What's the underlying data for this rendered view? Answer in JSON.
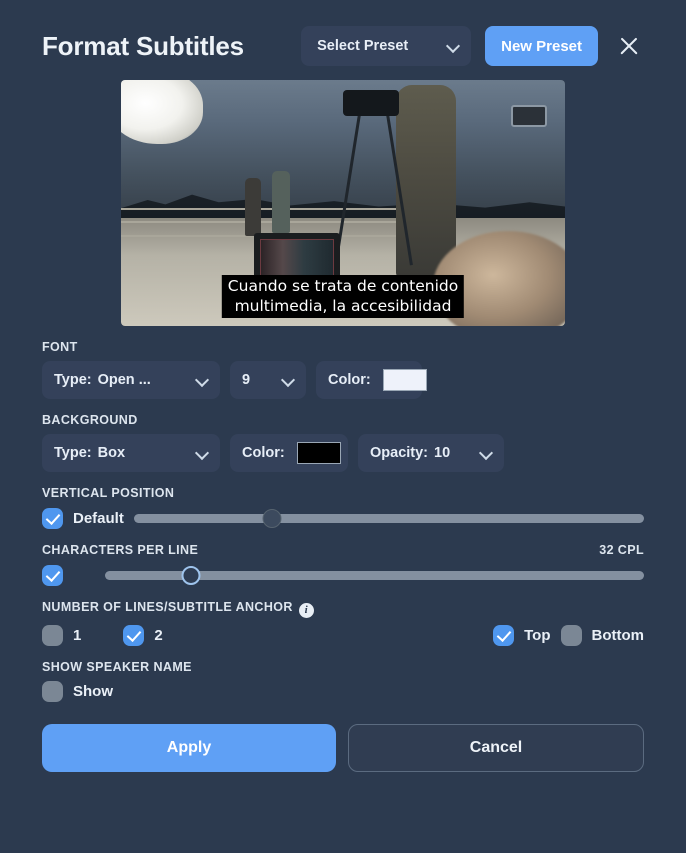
{
  "header": {
    "title": "Format Subtitles",
    "preset_select_label": "Select Preset",
    "new_preset_label": "New Preset",
    "close_label": "×"
  },
  "preview": {
    "subtitle_line1": "Cuando se trata de contenido",
    "subtitle_line2": "multimedia, la accesibilidad"
  },
  "font": {
    "section_label": "FONT",
    "type_label": "Type:",
    "type_value": "Open ...",
    "size_value": "9",
    "color_label": "Color:",
    "color_value": "#eef2fa"
  },
  "background": {
    "section_label": "BACKGROUND",
    "type_label": "Type:",
    "type_value": "Box",
    "color_label": "Color:",
    "color_value": "#000000",
    "opacity_label": "Opacity:",
    "opacity_value": "10"
  },
  "vertical_position": {
    "section_label": "VERTICAL POSITION",
    "default_label": "Default",
    "default_checked": true,
    "slider_percent": 27
  },
  "characters_per_line": {
    "section_label": "CHARACTERS PER LINE",
    "value_label": "32 CPL",
    "checked": true,
    "slider_percent": 16
  },
  "lines_anchor": {
    "section_label": "NUMBER OF LINES/SUBTITLE ANCHOR",
    "info_glyph": "i",
    "option_1_label": "1",
    "option_1_checked": false,
    "option_2_label": "2",
    "option_2_checked": true,
    "top_label": "Top",
    "top_checked": true,
    "bottom_label": "Bottom",
    "bottom_checked": false
  },
  "speaker_name": {
    "section_label": "SHOW SPEAKER NAME",
    "show_label": "Show",
    "show_checked": false
  },
  "footer": {
    "apply_label": "Apply",
    "cancel_label": "Cancel"
  },
  "colors": {
    "panel_bg": "#2c3a4f",
    "control_bg": "#34415a",
    "accent": "#5fa0f5",
    "checkbox_on": "#4f97ef",
    "checkbox_off": "#7b8795"
  }
}
